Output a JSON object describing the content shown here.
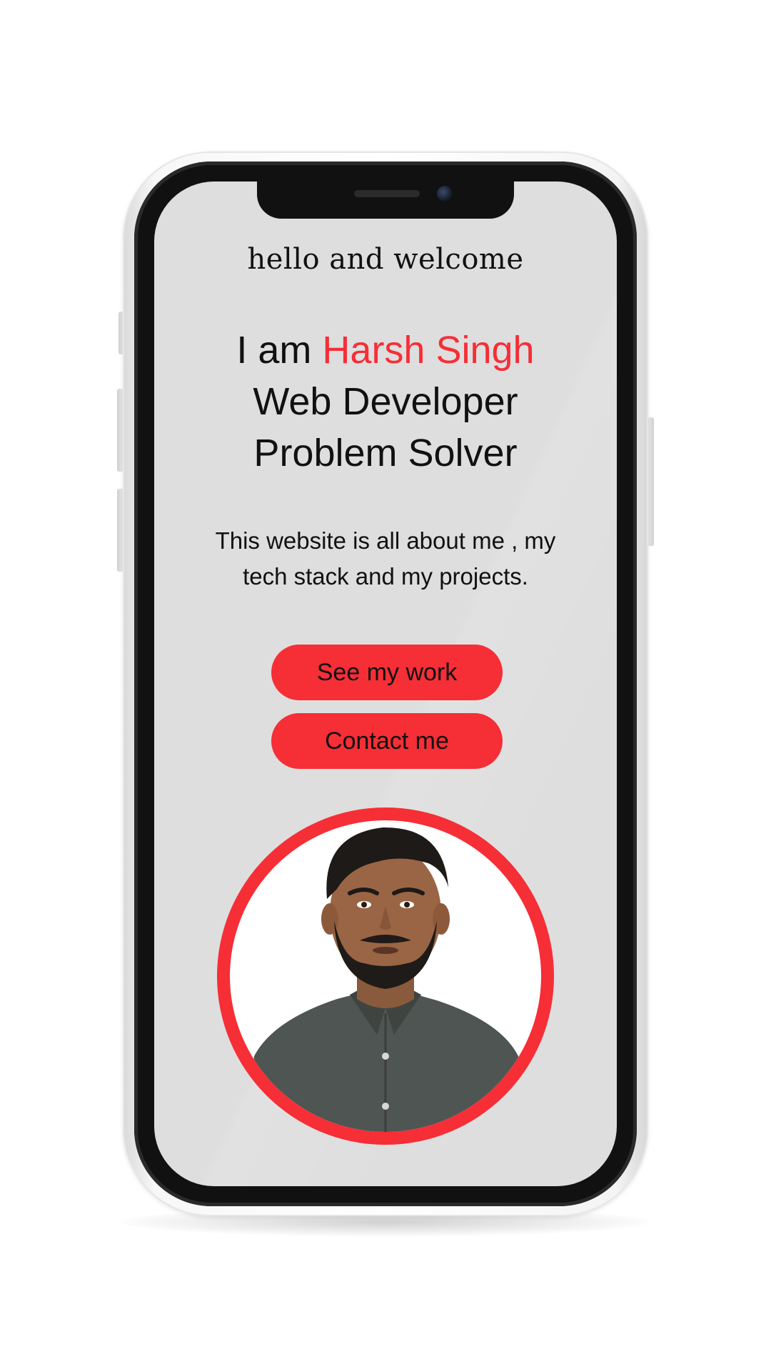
{
  "hero": {
    "welcome": "hello and welcome",
    "intro_prefix": "I am ",
    "name": "Harsh Singh",
    "role_1": "Web Developer",
    "role_2": "Problem Solver",
    "description": "This website is all about me , my tech stack and my projects."
  },
  "buttons": {
    "work_label": "See my work",
    "contact_label": "Contact me"
  },
  "avatar": {
    "icon": "portrait-photo"
  },
  "colors": {
    "accent": "#f62e36",
    "screen_bg": "#dedede",
    "text": "#111111"
  }
}
